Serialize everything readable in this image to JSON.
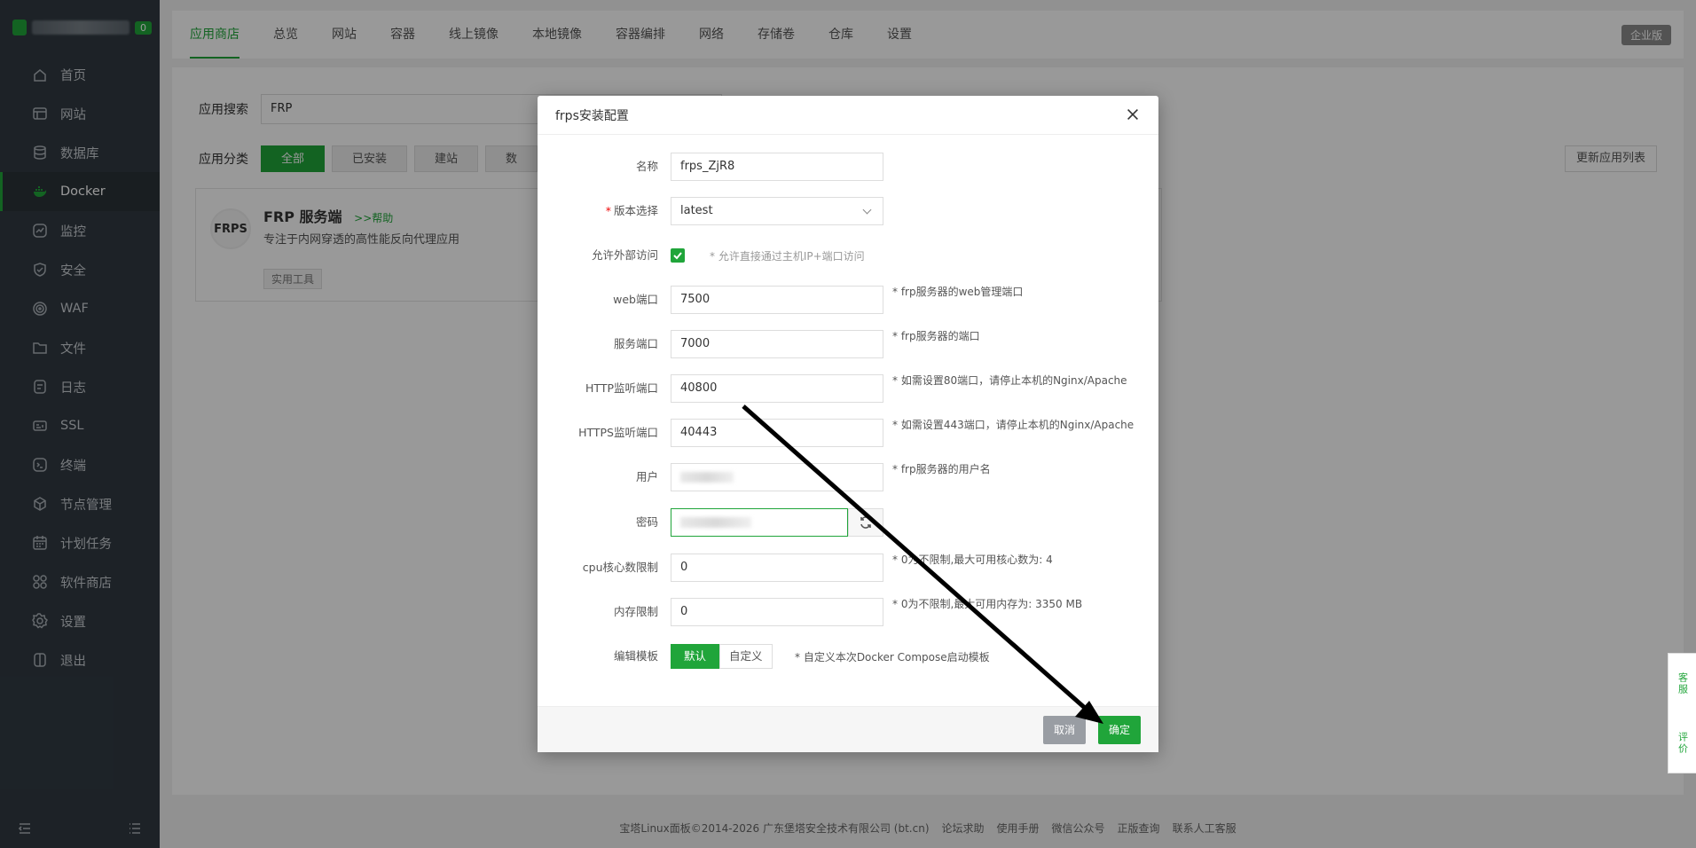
{
  "sidebar": {
    "badge": "0",
    "items": [
      {
        "label": "首页",
        "icon": "home-icon"
      },
      {
        "label": "网站",
        "icon": "website-icon"
      },
      {
        "label": "数据库",
        "icon": "database-icon"
      },
      {
        "label": "Docker",
        "icon": "docker-icon"
      },
      {
        "label": "监控",
        "icon": "monitor-icon"
      },
      {
        "label": "安全",
        "icon": "shield-icon"
      },
      {
        "label": "WAF",
        "icon": "waf-icon"
      },
      {
        "label": "文件",
        "icon": "folder-icon"
      },
      {
        "label": "日志",
        "icon": "log-icon"
      },
      {
        "label": "SSL",
        "icon": "ssl-icon"
      },
      {
        "label": "终端",
        "icon": "terminal-icon"
      },
      {
        "label": "节点管理",
        "icon": "node-icon"
      },
      {
        "label": "计划任务",
        "icon": "calendar-icon"
      },
      {
        "label": "软件商店",
        "icon": "store-icon"
      },
      {
        "label": "设置",
        "icon": "gear-icon"
      },
      {
        "label": "退出",
        "icon": "logout-icon"
      }
    ],
    "active": "Docker"
  },
  "topnav": {
    "tabs": [
      "应用商店",
      "总览",
      "网站",
      "容器",
      "线上镜像",
      "本地镜像",
      "容器编排",
      "网络",
      "存储卷",
      "仓库",
      "设置"
    ],
    "active": "应用商店",
    "enterprise": "企业版"
  },
  "content": {
    "search_label": "应用搜索",
    "search_value": "FRP",
    "category_label": "应用分类",
    "categories": [
      "全部",
      "已安装",
      "建站",
      "数"
    ],
    "update_button": "更新应用列表",
    "app": {
      "logo": "FRPS",
      "title": "FRP 服务端",
      "help": ">>帮助",
      "desc": "专注于内网穿透的高性能反向代理应用",
      "tag": "实用工具"
    }
  },
  "footer": {
    "copyright": "宝塔Linux面板©2014-2026 广东堡塔安全技术有限公司 (bt.cn)",
    "links": [
      "论坛求助",
      "使用手册",
      "微信公众号",
      "正版查询",
      "联系人工客服"
    ]
  },
  "float_panel": {
    "items": [
      "客服",
      "评价"
    ]
  },
  "modal": {
    "title": "frps安装配置",
    "fields": {
      "name": {
        "label": "名称",
        "value": "frps_ZjR8"
      },
      "version": {
        "label": "版本选择",
        "value": "latest"
      },
      "external": {
        "label": "允许外部访问",
        "hint": "* 允许直接通过主机IP+端口访问"
      },
      "web_port": {
        "label": "web端口",
        "value": "7500",
        "hint": "* frp服务器的web管理端口"
      },
      "service_port": {
        "label": "服务端口",
        "value": "7000",
        "hint": "* frp服务器的端口"
      },
      "http_port": {
        "label": "HTTP监听端口",
        "value": "40800",
        "hint": "* 如需设置80端口，请停止本机的Nginx/Apache"
      },
      "https_port": {
        "label": "HTTPS监听端口",
        "value": "40443",
        "hint": "* 如需设置443端口，请停止本机的Nginx/Apache"
      },
      "user": {
        "label": "用户",
        "hint": "* frp服务器的用户名"
      },
      "password": {
        "label": "密码"
      },
      "cpu": {
        "label": "cpu核心数限制",
        "value": "0",
        "hint": "* 0为不限制,最大可用核心数为: 4"
      },
      "memory": {
        "label": "内存限制",
        "value": "0",
        "hint": "* 0为不限制,最大可用内存为: 3350 MB"
      },
      "template": {
        "label": "编辑模板",
        "options": [
          "默认",
          "自定义"
        ],
        "hint": "* 自定义本次Docker Compose启动模板"
      }
    },
    "cancel": "取消",
    "confirm": "确定"
  }
}
